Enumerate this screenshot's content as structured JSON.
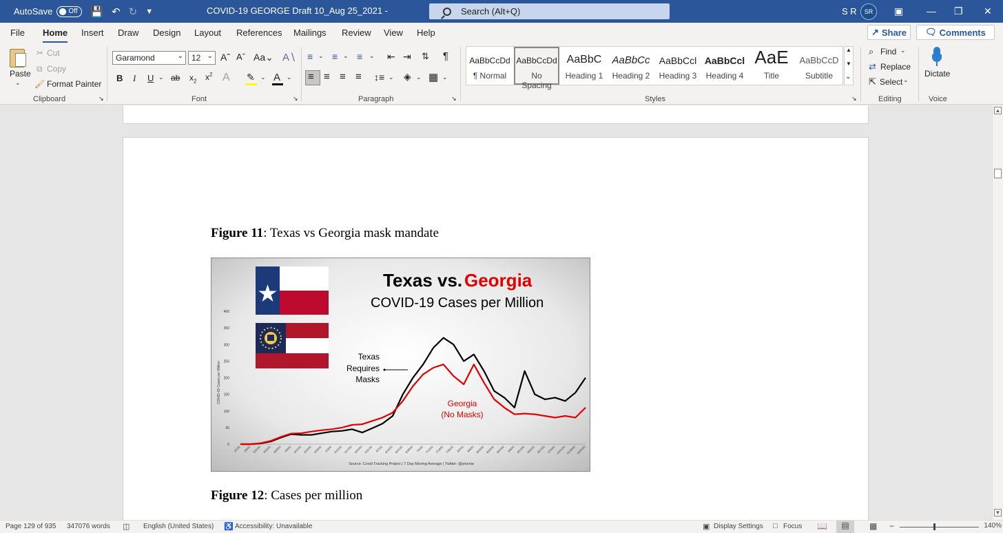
{
  "titlebar": {
    "autosave_label": "AutoSave",
    "autosave_state": "Off",
    "doc_title": "COVID-19 GEORGE Draft 10_Aug 25_2021  -",
    "search_placeholder": "Search (Alt+Q)",
    "user_initials": "S R",
    "avatar_initials": "SR"
  },
  "menu": {
    "tabs": [
      "File",
      "Home",
      "Insert",
      "Draw",
      "Design",
      "Layout",
      "References",
      "Mailings",
      "Review",
      "View",
      "Help"
    ],
    "active": "Home",
    "share": "Share",
    "comments": "Comments"
  },
  "ribbon": {
    "clipboard": {
      "paste": "Paste",
      "cut": "Cut",
      "copy": "Copy",
      "format_painter": "Format Painter",
      "label": "Clipboard"
    },
    "font": {
      "name": "Garamond",
      "size": "12",
      "label": "Font"
    },
    "paragraph": {
      "label": "Paragraph"
    },
    "styles": {
      "label": "Styles",
      "items": [
        {
          "preview": "AaBbCcDd",
          "name": "¶ Normal"
        },
        {
          "preview": "AaBbCcDd",
          "name": "No Spacing"
        },
        {
          "preview": "AaBbC",
          "name": "Heading 1"
        },
        {
          "preview": "AaBbCc",
          "name": "Heading 2"
        },
        {
          "preview": "AaBbCcl",
          "name": "Heading 3"
        },
        {
          "preview": "AaBbCcl",
          "name": "Heading 4"
        },
        {
          "preview": "AaE",
          "name": "Title"
        },
        {
          "preview": "AaBbCcD",
          "name": "Subtitle"
        }
      ]
    },
    "editing": {
      "find": "Find",
      "replace": "Replace",
      "select": "Select",
      "label": "Editing"
    },
    "voice": {
      "dictate": "Dictate",
      "label": "Voice"
    }
  },
  "document": {
    "figure11_num": "Figure 11",
    "figure11_text": ": Texas vs Georgia mask mandate",
    "figure12_num": "Figure 12",
    "figure12_text": ": Cases per million"
  },
  "chart_data": {
    "type": "line",
    "title_part1": "Texas vs.",
    "title_part2": "Georgia",
    "subtitle": "COVID-19 Cases per Million",
    "ylabel": "COVID-19 Cases per Million",
    "ylim": [
      0,
      400
    ],
    "yticks": [
      0,
      50,
      100,
      150,
      200,
      250,
      300,
      350,
      400
    ],
    "x": [
      "3/1/20",
      "3/8/20",
      "3/15/20",
      "3/22/20",
      "3/29/20",
      "4/5/20",
      "4/12/20",
      "4/19/20",
      "4/26/20",
      "5/3/20",
      "5/10/20",
      "5/17/20",
      "5/24/20",
      "5/31/20",
      "6/7/20",
      "6/14/20",
      "6/21/20",
      "6/28/20",
      "7/5/20",
      "7/12/20",
      "7/19/20",
      "7/26/20",
      "8/2/20",
      "8/9/20",
      "8/16/20",
      "8/23/20",
      "8/30/20",
      "9/6/20",
      "9/13/20",
      "9/20/20",
      "9/27/20",
      "10/4/20",
      "10/11/20",
      "10/18/20",
      "10/25/20"
    ],
    "series": [
      {
        "name": "Texas",
        "color": "#000000",
        "values": [
          0,
          0,
          2,
          8,
          20,
          30,
          28,
          28,
          33,
          38,
          40,
          45,
          35,
          48,
          62,
          85,
          150,
          200,
          240,
          290,
          320,
          300,
          250,
          270,
          220,
          160,
          140,
          110,
          220,
          150,
          135,
          140,
          130,
          155,
          200
        ]
      },
      {
        "name": "Georgia",
        "color": "#e00000",
        "values": [
          0,
          0,
          3,
          10,
          22,
          32,
          33,
          38,
          42,
          45,
          50,
          58,
          60,
          70,
          80,
          95,
          130,
          175,
          210,
          230,
          240,
          205,
          180,
          240,
          185,
          135,
          110,
          90,
          92,
          90,
          85,
          80,
          85,
          80,
          110
        ]
      }
    ],
    "annotations": [
      {
        "text_lines": [
          "Texas",
          "Requires",
          "Masks"
        ],
        "color": "#000000"
      },
      {
        "text_lines": [
          "Georgia",
          "(No Masks)"
        ],
        "color": "#e00000"
      }
    ],
    "source": "Source: Covid Tracking Project | 7 Day Moving Average | Twitter: @yinonw"
  },
  "statusbar": {
    "page": "Page 129 of 935",
    "words": "347076 words",
    "language": "English (United States)",
    "accessibility": "Accessibility: Unavailable",
    "display_settings": "Display Settings",
    "focus": "Focus",
    "zoom": "140%"
  }
}
